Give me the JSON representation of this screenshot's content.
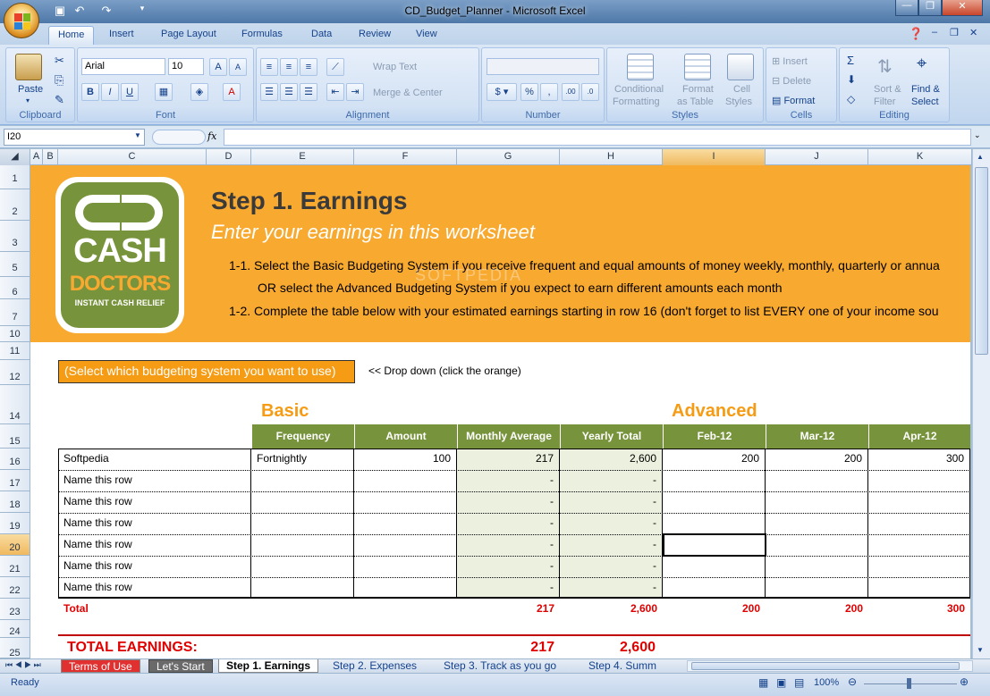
{
  "window": {
    "title": "CD_Budget_Planner - Microsoft Excel",
    "watermark": "SOFTPEDIA"
  },
  "ribbon_tabs": [
    "Home",
    "Insert",
    "Page Layout",
    "Formulas",
    "Data",
    "Review",
    "View"
  ],
  "ribbon": {
    "clipboard": {
      "label": "Clipboard",
      "paste": "Paste"
    },
    "font": {
      "label": "Font",
      "font_name": "Arial",
      "font_size": "10"
    },
    "alignment": {
      "label": "Alignment",
      "wrap_text": "Wrap Text",
      "merge_center": "Merge & Center"
    },
    "number": {
      "label": "Number",
      "format": ""
    },
    "styles": {
      "label": "Styles",
      "conditional": "Conditional",
      "conditional2": "Formatting",
      "format_as": "Format",
      "format_as2": "as Table",
      "cell": "Cell",
      "cell2": "Styles"
    },
    "cells": {
      "label": "Cells",
      "insert": "Insert",
      "delete": "Delete",
      "format": "Format"
    },
    "editing": {
      "label": "Editing",
      "sort": "Sort &",
      "sort2": "Filter",
      "find": "Find &",
      "find2": "Select"
    }
  },
  "formula_bar": {
    "name_box": "I20",
    "fx": "fx",
    "value": ""
  },
  "columns": [
    "A",
    "B",
    "C",
    "D",
    "E",
    "F",
    "G",
    "H",
    "I",
    "J",
    "K"
  ],
  "rows": [
    "1",
    "2",
    "3",
    "5",
    "6",
    "7",
    "10",
    "11",
    "12",
    "14",
    "15",
    "16",
    "17",
    "18",
    "19",
    "20",
    "21",
    "22",
    "23",
    "24",
    "25"
  ],
  "logo": {
    "line1": "CASH",
    "line2": "DOCTORS",
    "tagline": "INSTANT CASH RELIEF"
  },
  "sheet": {
    "step_title": "Step 1.  Earnings",
    "subtitle": "Enter your earnings in this worksheet",
    "instr1": "1-1.  Select the Basic Budgeting System if you receive frequent and equal amounts of money weekly, monthly, quarterly or annua",
    "instr1b": "OR select the Advanced Budgeting System if you expect to earn different amounts each month",
    "instr2": "1-2.  Complete the table below with your estimated earnings starting in row 16 (don't forget to list EVERY one of your income sou",
    "dropdown": "(Select which budgeting system you want to use)",
    "dropdown_hint": "<< Drop down (click the orange)",
    "basic": "Basic",
    "advanced": "Advanced",
    "headers": [
      "Frequency",
      "Amount",
      "Monthly Average",
      "Yearly Total",
      "Feb-12",
      "Mar-12",
      "Apr-12"
    ],
    "rows": [
      {
        "name": "Softpedia",
        "freq": "Fortnightly",
        "amount": "100",
        "monthly": "217",
        "yearly": "2,600",
        "feb": "200",
        "mar": "200",
        "apr": "300"
      },
      {
        "name": "Name this row",
        "freq": "",
        "amount": "",
        "monthly": "-",
        "yearly": "-",
        "feb": "",
        "mar": "",
        "apr": ""
      },
      {
        "name": "Name this row",
        "freq": "",
        "amount": "",
        "monthly": "-",
        "yearly": "-",
        "feb": "",
        "mar": "",
        "apr": ""
      },
      {
        "name": "Name this row",
        "freq": "",
        "amount": "",
        "monthly": "-",
        "yearly": "-",
        "feb": "",
        "mar": "",
        "apr": ""
      },
      {
        "name": "Name this row",
        "freq": "",
        "amount": "",
        "monthly": "-",
        "yearly": "-",
        "feb": "",
        "mar": "",
        "apr": ""
      },
      {
        "name": "Name this row",
        "freq": "",
        "amount": "",
        "monthly": "-",
        "yearly": "-",
        "feb": "",
        "mar": "",
        "apr": ""
      },
      {
        "name": "Name this row",
        "freq": "",
        "amount": "",
        "monthly": "-",
        "yearly": "-",
        "feb": "",
        "mar": "",
        "apr": ""
      }
    ],
    "total": {
      "label": "Total",
      "monthly": "217",
      "yearly": "2,600",
      "feb": "200",
      "mar": "200",
      "apr": "300"
    },
    "grand_total": {
      "label": "TOTAL EARNINGS:",
      "monthly": "217",
      "yearly": "2,600"
    }
  },
  "sheet_tabs": [
    "Terms of Use",
    "Let's Start",
    "Step 1. Earnings",
    "Step 2. Expenses",
    "Step 3. Track as you go",
    "Step 4. Summ"
  ],
  "status": {
    "ready": "Ready",
    "zoom": "100%"
  },
  "colors": {
    "accent_orange": "#f8a930",
    "header_green": "#77933c",
    "total_red": "#e00000",
    "section_orange": "#f59b14"
  }
}
